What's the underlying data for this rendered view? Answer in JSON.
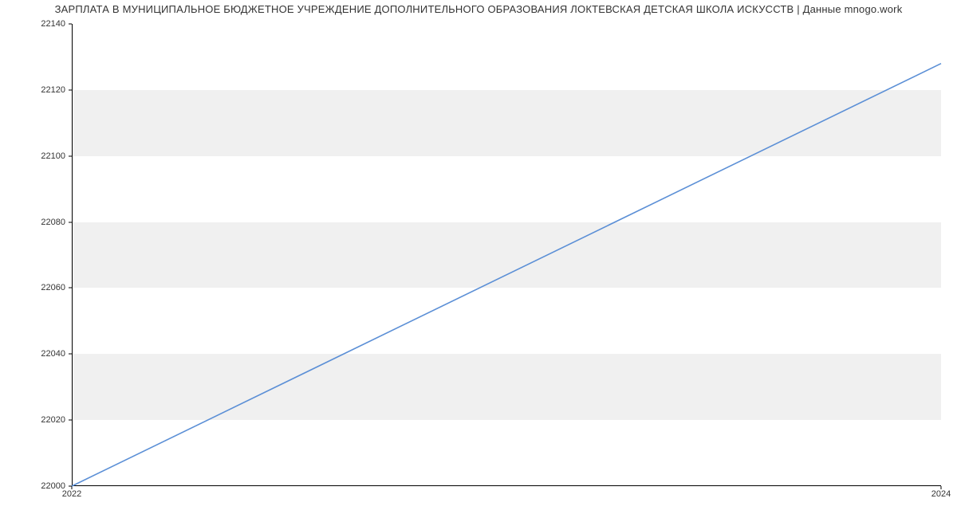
{
  "chart_data": {
    "type": "line",
    "title": "ЗАРПЛАТА В МУНИЦИПАЛЬНОЕ БЮДЖЕТНОЕ УЧРЕЖДЕНИЕ ДОПОЛНИТЕЛЬНОГО ОБРАЗОВАНИЯ ЛОКТЕВСКАЯ ДЕТСКАЯ ШКОЛА ИСКУССТВ | Данные mnogo.work",
    "xlabel": "",
    "ylabel": "",
    "x": [
      2022,
      2024
    ],
    "values": [
      22000,
      22128
    ],
    "x_ticks": [
      2022,
      2024
    ],
    "y_ticks": [
      22000,
      22020,
      22040,
      22060,
      22080,
      22100,
      22120,
      22140
    ],
    "xlim": [
      2022,
      2024
    ],
    "ylim": [
      22000,
      22140
    ],
    "line_color": "#5b8fd6",
    "band_color": "#f0f0f0"
  }
}
